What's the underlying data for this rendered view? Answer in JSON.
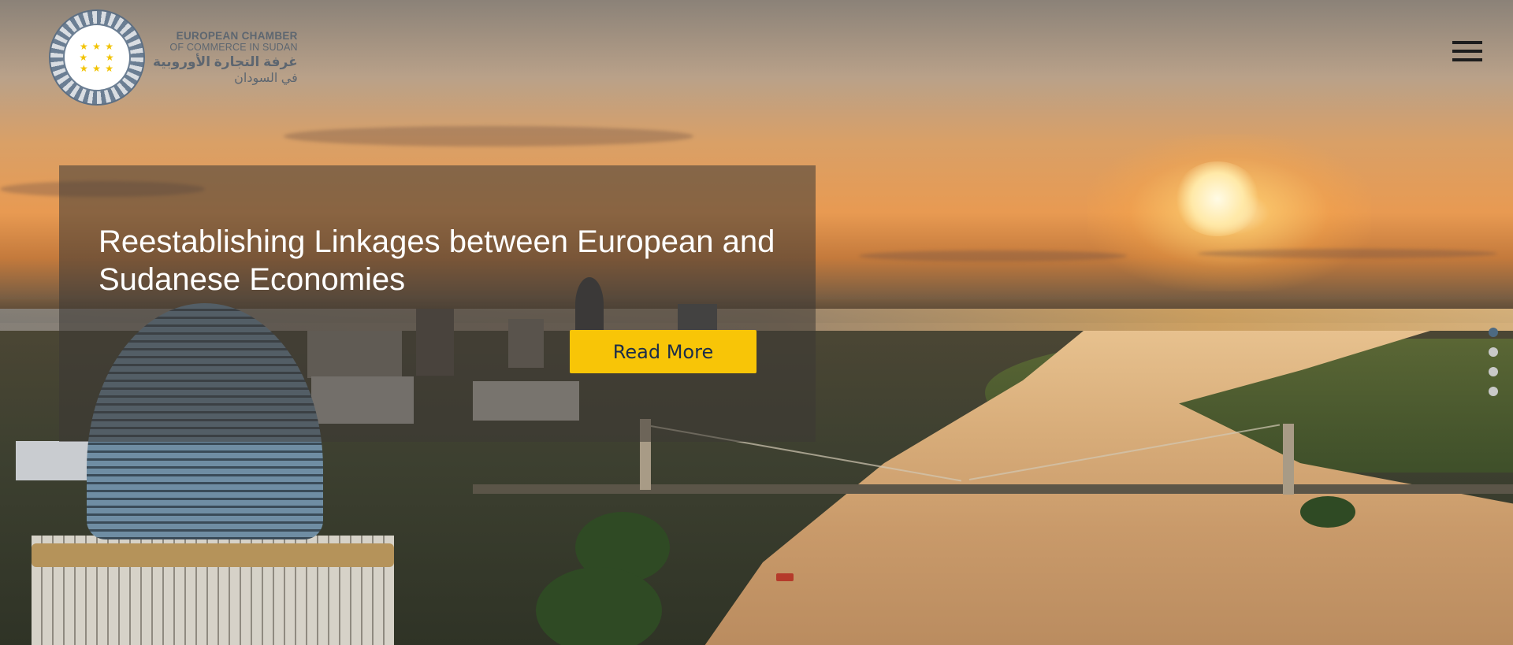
{
  "logo": {
    "line1": "EUROPEAN CHAMBER",
    "line2": "OF COMMERCE IN SUDAN",
    "line3": "غرفة التجارة الأوروبية",
    "line4": "في السودان",
    "emblem_icon": "eu-stars-emblem-icon"
  },
  "header": {
    "menu_icon": "hamburger-menu-icon"
  },
  "hero": {
    "headline": "Reestablishing Linkages between European and Sudanese Economies",
    "button_label": "Read More",
    "slides": {
      "count": 4,
      "active_index": 0
    }
  },
  "colors": {
    "accent_button": "#f8c507",
    "button_text": "#1b2d4a",
    "dot_active": "#4d6a82",
    "dot_inactive": "#c9c9c9"
  }
}
